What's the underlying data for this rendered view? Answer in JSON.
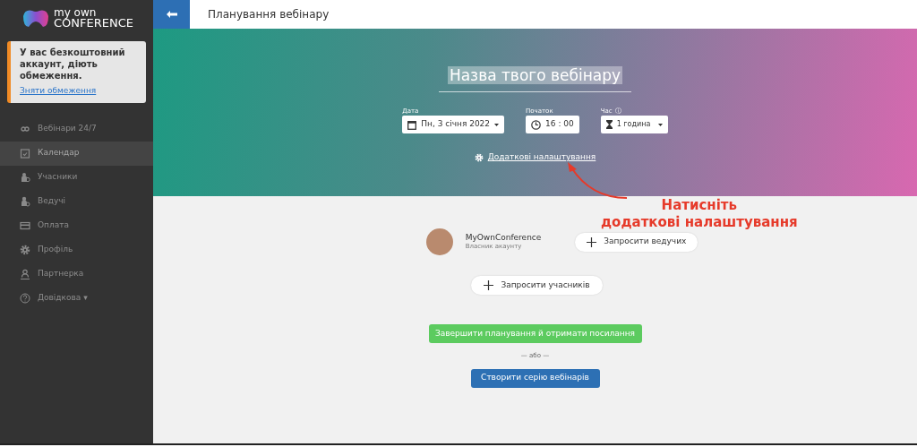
{
  "logo": {
    "line1": "my own",
    "line2": "CONFERENCE"
  },
  "notice": {
    "text": "У вас безкоштовний аккаунт, діють обмеження.",
    "link": "Зняти обмеження"
  },
  "sidebar": {
    "items": [
      {
        "kind": "infinity",
        "label": "Вебінари 24/7",
        "selected": false
      },
      {
        "kind": "calendar",
        "label": "Календар",
        "selected": true
      },
      {
        "kind": "people",
        "label": "Учасники",
        "selected": false
      },
      {
        "kind": "person",
        "label": "Ведучі",
        "selected": false
      },
      {
        "kind": "card",
        "label": "Оплата",
        "selected": false
      },
      {
        "kind": "gear",
        "label": "Профіль",
        "selected": false
      },
      {
        "kind": "partner",
        "label": "Партнерка",
        "selected": false
      },
      {
        "kind": "help",
        "label": "Довідкова ▾",
        "selected": false
      }
    ]
  },
  "header": {
    "title": "Планування вебінару"
  },
  "hero": {
    "webinar_name": "Назва твого вебінару",
    "date": {
      "label": "Дата",
      "value": "Пн, 3 січня 2022"
    },
    "start": {
      "label": "Початок",
      "value": "16 : 00"
    },
    "duration": {
      "label": "Час",
      "info": "ⓘ",
      "value": "1 година"
    },
    "settings_link": "Додаткові налаштування"
  },
  "annotation": {
    "line1": "Натисніть",
    "line2": "додаткові налаштування"
  },
  "host": {
    "name": "MyOwnConference",
    "role": "Власник акаунту"
  },
  "invite_hosts": "Запросити ведучих",
  "invite_participants": "Запросити учасників",
  "finish_button": "Завершити планування й отримати посилання",
  "separator": "— або —",
  "series_button": "Створити серію вебінарів"
}
